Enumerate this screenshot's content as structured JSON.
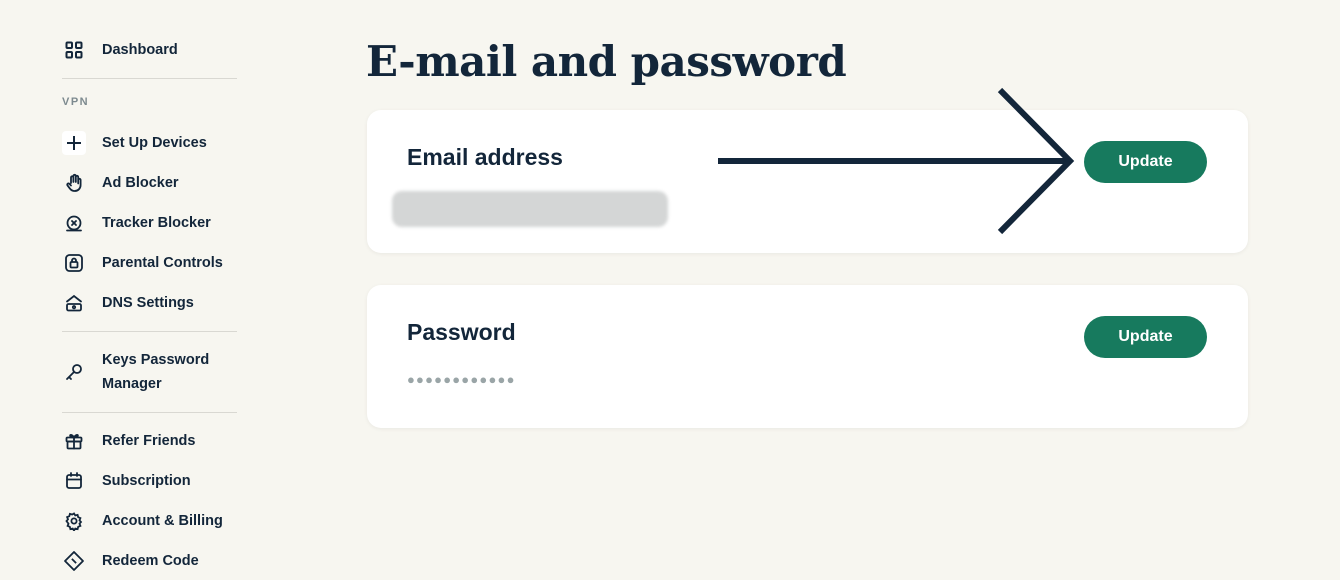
{
  "sidebar": {
    "dashboard": "Dashboard",
    "section_vpn": "VPN",
    "items": [
      {
        "label": "Set Up Devices",
        "icon": "plus-icon"
      },
      {
        "label": "Ad Blocker",
        "icon": "hand-icon"
      },
      {
        "label": "Tracker Blocker",
        "icon": "tracker-blocker-icon"
      },
      {
        "label": "Parental Controls",
        "icon": "lock-icon"
      },
      {
        "label": "DNS Settings",
        "icon": "dns-icon"
      }
    ],
    "keys": "Keys Password Manager",
    "bottom": [
      {
        "label": "Refer Friends",
        "icon": "gift-icon"
      },
      {
        "label": "Subscription",
        "icon": "calendar-icon"
      },
      {
        "label": "Account & Billing",
        "icon": "gear-icon"
      },
      {
        "label": "Redeem Code",
        "icon": "ticket-icon"
      }
    ]
  },
  "main": {
    "title": "E-mail and password",
    "email_card": {
      "title": "Email address",
      "button": "Update"
    },
    "password_card": {
      "title": "Password",
      "masked_value": "●●●●●●●●●●●●",
      "button": "Update"
    }
  },
  "colors": {
    "background": "#f7f6f0",
    "accent": "#177a5e",
    "text": "#13263a"
  }
}
